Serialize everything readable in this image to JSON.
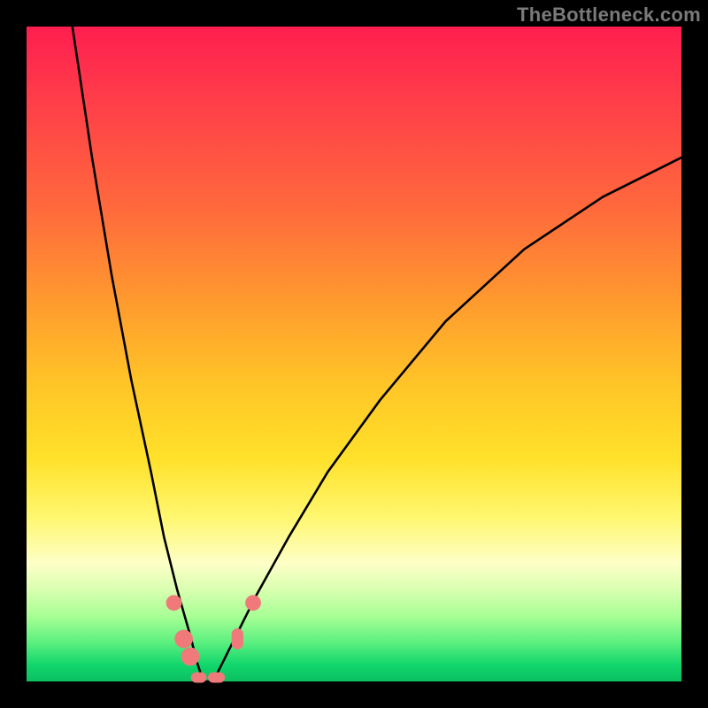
{
  "watermark": "TheBottleneck.com",
  "chart_data": {
    "type": "line",
    "title": "",
    "xlabel": "",
    "ylabel": "",
    "xlim": [
      0,
      100
    ],
    "ylim": [
      0,
      100
    ],
    "gradient_bands": [
      {
        "label": "red",
        "approx_y_pct": 100
      },
      {
        "label": "orange",
        "approx_y_pct": 60
      },
      {
        "label": "yellow",
        "approx_y_pct": 30
      },
      {
        "label": "green",
        "approx_y_pct": 0
      }
    ],
    "series": [
      {
        "name": "bottleneck-curve",
        "note": "V-shaped curve; minimum near x≈27 where y≈0; left arm rises steeply to y≈100 at x≈7; right arm rises gradually to y≈80 at x≈100",
        "x": [
          7,
          10,
          13,
          16,
          19,
          21,
          23,
          25,
          26,
          27,
          28,
          29,
          30,
          32,
          35,
          40,
          46,
          54,
          64,
          76,
          88,
          100
        ],
        "y": [
          100,
          80,
          62,
          46,
          32,
          22,
          14,
          7,
          3,
          0,
          0,
          1,
          3,
          7,
          13,
          22,
          32,
          43,
          55,
          66,
          74,
          80
        ]
      }
    ],
    "markers": [
      {
        "name": "left-arm-dot-1",
        "x": 22.5,
        "y": 12,
        "r": 1.2,
        "shape": "circle"
      },
      {
        "name": "left-arm-dot-2",
        "x": 24.0,
        "y": 6.5,
        "r": 1.4,
        "shape": "circle"
      },
      {
        "name": "left-arm-dot-3",
        "x": 25.0,
        "y": 3.8,
        "r": 1.4,
        "shape": "circle"
      },
      {
        "name": "valley-pill-1",
        "x": 26.3,
        "y": 0.6,
        "w": 2.4,
        "h": 1.6,
        "shape": "pill"
      },
      {
        "name": "valley-pill-2",
        "x": 29.0,
        "y": 0.6,
        "w": 2.6,
        "h": 1.6,
        "shape": "pill"
      },
      {
        "name": "right-arm-pill",
        "x": 32.2,
        "y": 6.5,
        "w": 1.8,
        "h": 3.2,
        "shape": "pill"
      },
      {
        "name": "right-arm-dot-1",
        "x": 34.6,
        "y": 12,
        "r": 1.2,
        "shape": "circle"
      }
    ],
    "marker_color": "#f07a7a"
  }
}
